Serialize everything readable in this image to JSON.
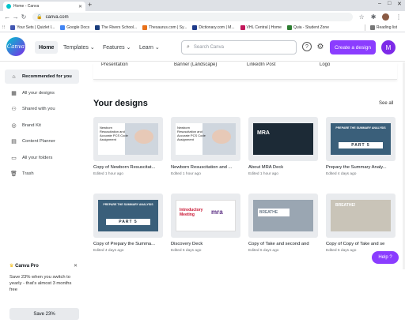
{
  "browser": {
    "tab_title": "Home - Canva",
    "url": "canva.com",
    "bookmarks": [
      {
        "label": "Your Sets | Quizlet I...",
        "color": "#4257b2"
      },
      {
        "label": "Google Docs",
        "color": "#4285f4"
      },
      {
        "label": "The Rivers School...",
        "color": "#1a3d7c"
      },
      {
        "label": "Thesaurus.com | Sy...",
        "color": "#e8711a"
      },
      {
        "label": "Dictionary.com | M...",
        "color": "#1e3a8a"
      },
      {
        "label": "VHL Central | Home",
        "color": "#c2185b"
      },
      {
        "label": "Quia - Student Zone",
        "color": "#2e7d32"
      },
      {
        "label": "Reading list",
        "color": "#777777"
      }
    ]
  },
  "header": {
    "logo_text": "Canva",
    "nav": [
      {
        "label": "Home"
      },
      {
        "label": "Templates",
        "chev": "⌄"
      },
      {
        "label": "Features",
        "chev": "⌄"
      },
      {
        "label": "Learn",
        "chev": "⌄"
      }
    ],
    "search_placeholder": "Search Canva",
    "create_button": "Create a design",
    "user_initial": "M",
    "accent": "#8b3dff"
  },
  "sidebar": {
    "items": [
      {
        "label": "Recommended for you",
        "icon": "home-icon",
        "glyph": "⌂"
      },
      {
        "label": "All your designs",
        "icon": "designs-icon",
        "glyph": "▦"
      },
      {
        "label": "Shared with you",
        "icon": "shared-icon",
        "glyph": "⚇"
      },
      {
        "label": "Brand Kit",
        "icon": "brand-kit-icon",
        "glyph": "◎"
      },
      {
        "label": "Content Planner",
        "icon": "calendar-icon",
        "glyph": "▤"
      },
      {
        "label": "All your folders",
        "icon": "folder-icon",
        "glyph": "▭"
      },
      {
        "label": "Trash",
        "icon": "trash-icon",
        "glyph": "🗑"
      }
    ],
    "promo": {
      "title": "Canva Pro",
      "description": "Save 23% when you switch to yearly - that's almost 3 months free",
      "button": "Save 23%"
    }
  },
  "design_types": [
    "Presentation",
    "Banner (Landscape)",
    "LinkedIn Post",
    "Logo"
  ],
  "designs": {
    "heading": "Your designs",
    "see_all": "See all",
    "cards": [
      {
        "title": "Copy of Newborn Resuscitat...",
        "subtitle": "Edited 1 hour ago",
        "thumb": "newborn",
        "thumb_text": "Newborn Resuscitation and Accurate PCS Code Assignment"
      },
      {
        "title": "Newborn Resuscitation and ...",
        "subtitle": "Edited 1 hour ago",
        "thumb": "newborn",
        "thumb_text": "Newborn Resuscitation and Accurate PCS Code Assignment"
      },
      {
        "title": "About MRA Deck",
        "subtitle": "Edited 1 hour ago",
        "thumb": "dark",
        "thumb_text": "MRA"
      },
      {
        "title": "Prepary the Summary Analy...",
        "subtitle": "Edited 4 days ago",
        "thumb": "summary",
        "thumb_text": "PREPARE THE SUMMARY ANALYSIS",
        "thumb_part": "PART 5"
      },
      {
        "title": "Copy of Prepary the Summa...",
        "subtitle": "Edited 4 days ago",
        "thumb": "summary",
        "thumb_text": "PREPARE THE SUMMARY ANALYSIS",
        "thumb_part": "PART 5"
      },
      {
        "title": "Discovery Deck",
        "subtitle": "Edited 6 days ago",
        "thumb": "intro",
        "thumb_text": "Introductory Meeting",
        "thumb_part": "mra"
      },
      {
        "title": "Copy of Take and second and",
        "subtitle": "Edited 6 days ago",
        "thumb": "breathe",
        "thumb_text": "BREATHE"
      },
      {
        "title": "Copy of Copy of Take and se",
        "subtitle": "Edited 6 days ago",
        "thumb": "breathe2",
        "thumb_text": "BREATHE!"
      }
    ]
  },
  "help_button": "Help ?"
}
